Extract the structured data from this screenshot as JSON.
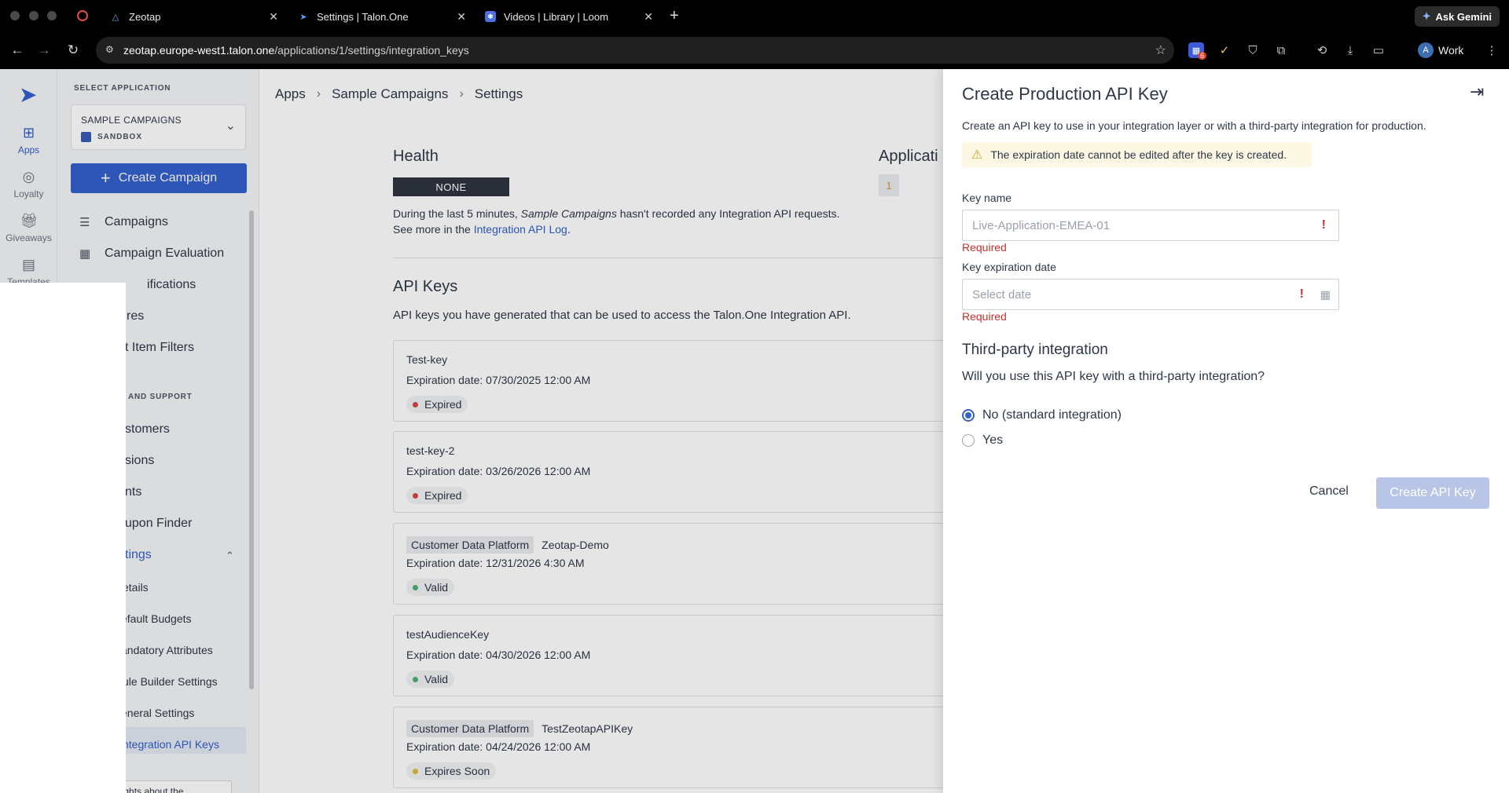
{
  "browser": {
    "tabs": [
      {
        "title": "Zeotap"
      },
      {
        "title": "Settings | Talon.One"
      },
      {
        "title": "Videos | Library | Loom"
      }
    ],
    "gemini_label": "Ask Gemini",
    "url_host": "zeotap.europe-west1.talon.one",
    "url_path": "/applications/1/settings/integration_keys",
    "profile_initial": "A",
    "profile_label": "Work",
    "extension_badge": "6"
  },
  "rail": {
    "items": [
      {
        "label": "Apps"
      },
      {
        "label": "Loyalty"
      },
      {
        "label": "Giveaways"
      },
      {
        "label": "Templates"
      }
    ]
  },
  "sidenav": {
    "select_label": "SELECT APPLICATION",
    "app_name": "SAMPLE CAMPAIGNS",
    "app_env": "SANDBOX",
    "create_label": "Create Campaign",
    "items": [
      {
        "label": "Campaigns"
      },
      {
        "label": "Campaign Evaluation"
      },
      {
        "label": "ifications"
      },
      {
        "label": "res"
      },
      {
        "label": "t Item Filters"
      }
    ],
    "section_header": "AND SUPPORT",
    "section_items": [
      {
        "label": "stomers"
      },
      {
        "label": "sions"
      },
      {
        "label": "nts"
      },
      {
        "label": "upon Finder"
      },
      {
        "label": "tings"
      }
    ],
    "sub_items": [
      {
        "label": "etails"
      },
      {
        "label": "efault Budgets"
      },
      {
        "label": "andatory Attributes"
      },
      {
        "label": "ule Builder Settings"
      },
      {
        "label": "eneral Settings"
      },
      {
        "label": "ntegration API Keys"
      }
    ],
    "feedback_label": "Thoughts about the"
  },
  "main": {
    "breadcrumbs": [
      "Apps",
      "Sample Campaigns",
      "Settings"
    ],
    "health_title": "Health",
    "health_badge": "NONE",
    "health_text_1a": "During the last 5 minutes, ",
    "health_text_1b": "Sample Campaigns",
    "health_text_1c": " hasn't recorded any Integration API requests.",
    "health_text_2a": "See more in the ",
    "health_text_2b": "Integration API Log",
    "health_text_2c": ".",
    "applic_title": "Applicati",
    "applic_chip": "1",
    "apikeys_title": "API Keys",
    "apikeys_desc": "API keys you have generated that can be used to access the Talon.One Integration API.",
    "keys": [
      {
        "tag": "",
        "name": "Test-key",
        "expiration": "Expiration date: 07/30/2025 12:00 AM",
        "status": "Expired",
        "status_color": "#d64545"
      },
      {
        "tag": "",
        "name": "test-key-2",
        "expiration": "Expiration date: 03/26/2026 12:00 AM",
        "status": "Expired",
        "status_color": "#d64545"
      },
      {
        "tag": "Customer Data Platform",
        "name": "Zeotap-Demo",
        "expiration": "Expiration date: 12/31/2026 4:30 AM",
        "status": "Valid",
        "status_color": "#4caf72"
      },
      {
        "tag": "",
        "name": "testAudienceKey",
        "expiration": "Expiration date: 04/30/2026 12:00 AM",
        "status": "Valid",
        "status_color": "#4caf72"
      },
      {
        "tag": "Customer Data Platform",
        "name": "TestZeotapAPIKey",
        "expiration": "Expiration date: 04/24/2026 12:00 AM",
        "status": "Expires Soon",
        "status_color": "#e0b93a"
      }
    ]
  },
  "drawer": {
    "title": "Create Production API Key",
    "description": "Create an API key to use in your integration layer or with a third-party integration for production.",
    "warning": "The expiration date cannot be edited after the key is created.",
    "key_name_label": "Key name",
    "key_name_placeholder": "Live-Application-EMEA-01",
    "required": "Required",
    "exp_label": "Key expiration date",
    "exp_placeholder": "Select date",
    "third_party_title": "Third-party integration",
    "third_party_question": "Will you use this API key with a third-party integration?",
    "option_no": "No (standard integration)",
    "option_yes": "Yes",
    "cancel_label": "Cancel",
    "create_label": "Create API Key"
  }
}
